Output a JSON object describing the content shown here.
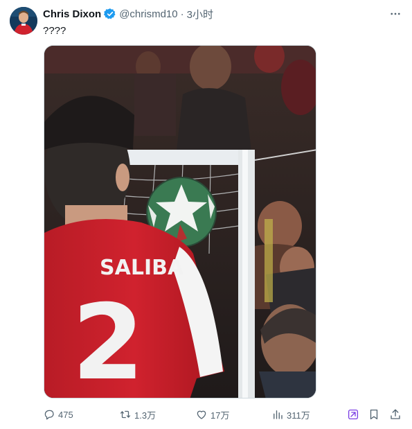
{
  "tweet": {
    "author_name": "Chris Dixon",
    "handle": "@chrismd10",
    "separator": "·",
    "time": "3小时",
    "text": "????",
    "media": {
      "jersey_name": "SALIBA",
      "jersey_number": "2"
    },
    "actions": {
      "replies": "475",
      "reposts": "1.3万",
      "likes": "17万",
      "views": "311万"
    }
  },
  "colors": {
    "verified": "#1d9bf0",
    "grok_icon": "#7b3fe4",
    "muted": "#536471",
    "text": "#0f1419",
    "jersey_red": "#d0222e"
  },
  "icons": [
    "verified-badge-icon",
    "more-options-icon",
    "reply-icon",
    "repost-icon",
    "like-icon",
    "views-icon",
    "grok-icon",
    "bookmark-icon",
    "share-icon"
  ]
}
